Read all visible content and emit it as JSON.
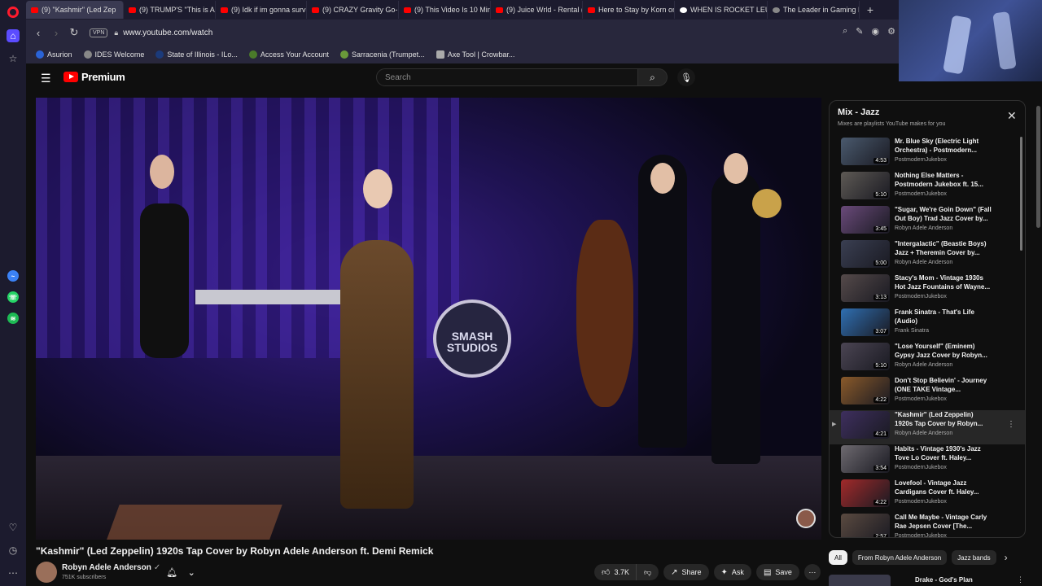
{
  "browser": {
    "tabs": [
      {
        "label": "(9) \"Kashmir\" (Led Zep",
        "active": true,
        "icon": "youtube-icon"
      },
      {
        "label": "(9) TRUMP'S \"This is Amer",
        "icon": "youtube-icon"
      },
      {
        "label": "(9) Idk if im gonna survi",
        "icon": "youtube-icon"
      },
      {
        "label": "(9) CRAZY Gravity Go-Kar",
        "icon": "youtube-icon"
      },
      {
        "label": "(9) This Video Is 10 Minut",
        "icon": "youtube-icon"
      },
      {
        "label": "(9) Juice Wrld - Rental (un",
        "icon": "youtube-icon"
      },
      {
        "label": "Here to Stay by Korn on P",
        "icon": "youtube-icon"
      },
      {
        "label": "WHEN IS ROCKET LEUAGE",
        "icon": "google-icon"
      },
      {
        "label": "The Leader in Gaming Ene",
        "icon": "web-icon"
      }
    ],
    "new_tab": "+",
    "vpn_label": "VPN",
    "url": "www.youtube.com/watch",
    "bookmarks": [
      "Asurion",
      "IDES Welcome",
      "State of Illinois - ILo...",
      "Access Your Account",
      "Sarracenia (Trumpet...",
      "Axe Tool | Crowbar..."
    ]
  },
  "youtube": {
    "logo_text": "Premium",
    "search_placeholder": "Search"
  },
  "video": {
    "title": "\"Kashmir\" (Led Zeppelin) 1920s Tap Cover by Robyn Adele Anderson ft. Demi Remick",
    "drum_label": "SMASH STUDIOS",
    "channel": "Robyn Adele Anderson",
    "subscribers": "751K subscribers",
    "likes": "3.7K",
    "share": "Share",
    "ask": "Ask",
    "save": "Save"
  },
  "playlist": {
    "title": "Mix - Jazz",
    "subtitle": "Mixes are playlists YouTube makes for you",
    "items": [
      {
        "title": "Mr. Blue Sky (Electric Light Orchestra) - Postmodern...",
        "channel": "PostmodernJukebox",
        "duration": "4:53",
        "color": "#4a5a6e"
      },
      {
        "title": "Nothing Else Matters - Postmodern Jukebox ft. 15...",
        "channel": "PostmodernJukebox",
        "duration": "5:10",
        "color": "#5e5a55"
      },
      {
        "title": "\"Sugar, We're Goin Down\" (Fall Out Boy) Trad Jazz Cover by...",
        "channel": "Robyn Adele Anderson",
        "duration": "3:45",
        "color": "#6a4a7a"
      },
      {
        "title": "\"Intergalactic\" (Beastie Boys) Jazz + Theremin Cover by...",
        "channel": "Robyn Adele Anderson",
        "duration": "5:00",
        "color": "#3a3f52"
      },
      {
        "title": "Stacy's Mom - Vintage 1930s Hot Jazz Fountains of Wayne...",
        "channel": "PostmodernJukebox",
        "duration": "3:13",
        "color": "#554a4a"
      },
      {
        "title": "Frank Sinatra - That's Life (Audio)",
        "channel": "Frank Sinatra",
        "duration": "3:07",
        "color": "#2f6fb2"
      },
      {
        "title": "\"Lose Yourself\" (Eminem) Gypsy Jazz Cover by Robyn...",
        "channel": "Robyn Adele Anderson",
        "duration": "5:10",
        "color": "#4b4553"
      },
      {
        "title": "Don't Stop Believin' - Journey (ONE TAKE Vintage...",
        "channel": "PostmodernJukebox",
        "duration": "4:22",
        "color": "#8a5a2a"
      },
      {
        "title": "\"Kashmir\" (Led Zeppelin) 1920s Tap Cover by Robyn...",
        "channel": "Robyn Adele Anderson",
        "duration": "4:21",
        "color": "#3e2f5e",
        "current": true
      },
      {
        "title": "Habits - Vintage 1930's Jazz Tove Lo Cover ft. Haley...",
        "channel": "PostmodernJukebox",
        "duration": "3:54",
        "color": "#6e6a70"
      },
      {
        "title": "Lovefool - Vintage Jazz Cardigans Cover ft. Haley...",
        "channel": "PostmodernJukebox",
        "duration": "4:22",
        "color": "#a22a2a"
      },
      {
        "title": "Call Me Maybe - Vintage Carly Rae Jepsen Cover [The...",
        "channel": "PostmodernJukebox",
        "duration": "2:57",
        "color": "#5a4a40"
      }
    ]
  },
  "chips": [
    "All",
    "From Robyn Adele Anderson",
    "Jazz bands"
  ],
  "next_video": {
    "title": "Drake - God's Plan"
  }
}
